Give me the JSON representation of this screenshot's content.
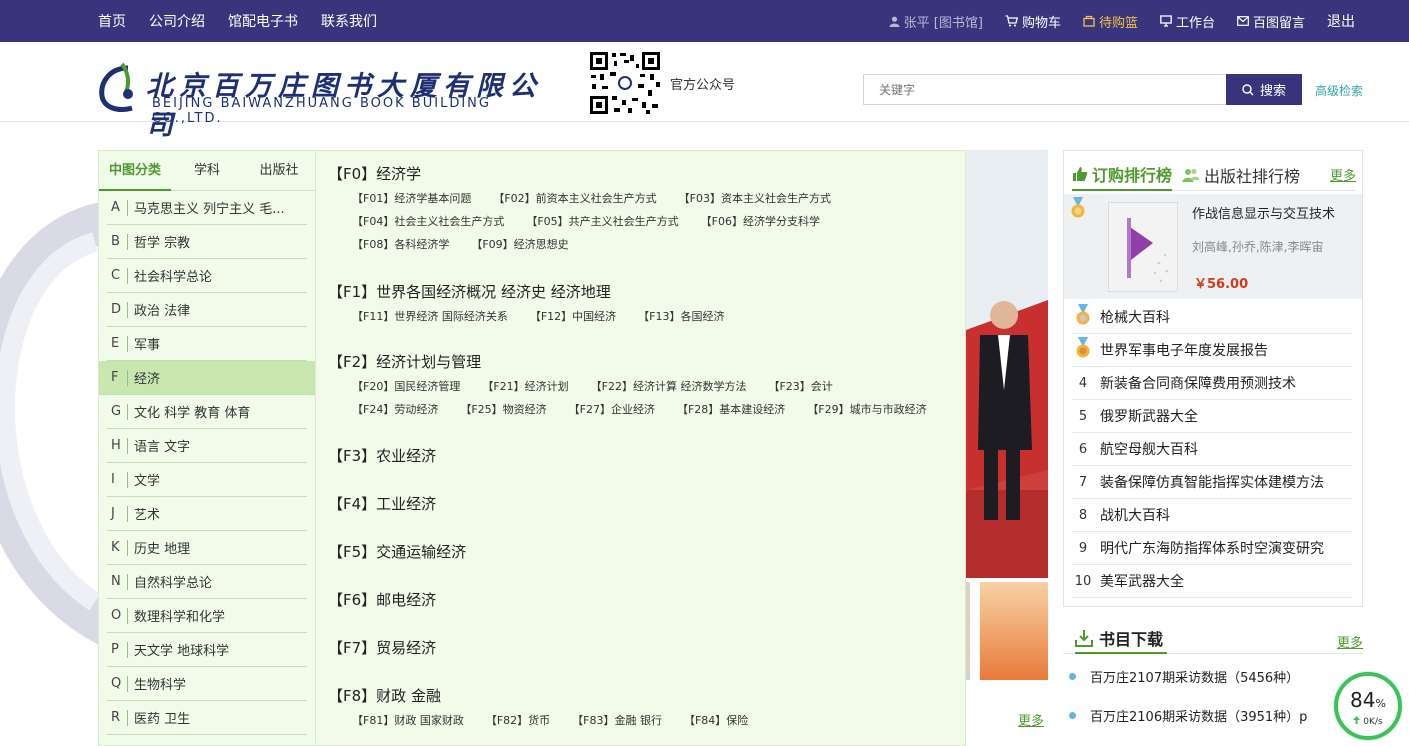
{
  "topnav": {
    "links": [
      "首页",
      "公司介绍",
      "馆配电子书",
      "联系我们"
    ],
    "user": "张平 [图书馆]",
    "cart": "购物车",
    "basket": "待购篮",
    "workbench": "工作台",
    "message": "百图留言",
    "logout": "退出"
  },
  "header": {
    "logo_cn": "北京百万庄图书大厦有限公司",
    "logo_en": "BEIJING BAIWANZHUANG BOOK BUILDING CO.,LTD.",
    "qr_label": "官方公众号",
    "search_placeholder": "关键字",
    "search_button": "搜索",
    "advanced_search": "高级检索"
  },
  "category_tabs": [
    "中图分类",
    "学科",
    "出版社"
  ],
  "categories": [
    {
      "code": "A",
      "name": "马克思主义 列宁主义 毛..."
    },
    {
      "code": "B",
      "name": "哲学 宗教"
    },
    {
      "code": "C",
      "name": "社会科学总论"
    },
    {
      "code": "D",
      "name": "政治 法律"
    },
    {
      "code": "E",
      "name": "军事"
    },
    {
      "code": "F",
      "name": "经济",
      "active": true
    },
    {
      "code": "G",
      "name": "文化 科学 教育 体育"
    },
    {
      "code": "H",
      "name": "语言 文字"
    },
    {
      "code": "I",
      "name": "文学"
    },
    {
      "code": "J",
      "name": "艺术"
    },
    {
      "code": "K",
      "name": "历史 地理"
    },
    {
      "code": "N",
      "name": "自然科学总论"
    },
    {
      "code": "O",
      "name": "数理科学和化学"
    },
    {
      "code": "P",
      "name": "天文学 地球科学"
    },
    {
      "code": "Q",
      "name": "生物科学"
    },
    {
      "code": "R",
      "name": "医药 卫生"
    }
  ],
  "subcategories": [
    {
      "head": "【F0】经济学",
      "items": [
        "【F01】经济学基本问题",
        "【F02】前资本主义社会生产方式",
        "【F03】资本主义社会生产方式",
        "【F04】社会主义社会生产方式",
        "【F05】共产主义社会生产方式",
        "【F06】经济学分支科学",
        "【F08】各科经济学",
        "【F09】经济思想史"
      ]
    },
    {
      "head": "【F1】世界各国经济概况 经济史 经济地理",
      "items": [
        "【F11】世界经济 国际经济关系",
        "【F12】中国经济",
        "【F13】各国经济"
      ]
    },
    {
      "head": "【F2】经济计划与管理",
      "items": [
        "【F20】国民经济管理",
        "【F21】经济计划",
        "【F22】经济计算 经济数学方法",
        "【F23】会计",
        "【F24】劳动经济",
        "【F25】物资经济",
        "【F27】企业经济",
        "【F28】基本建设经济",
        "【F29】城市与市政经济"
      ]
    },
    {
      "head": "【F3】农业经济",
      "items": []
    },
    {
      "head": "【F4】工业经济",
      "items": []
    },
    {
      "head": "【F5】交通运输经济",
      "items": []
    },
    {
      "head": "【F6】邮电经济",
      "items": []
    },
    {
      "head": "【F7】贸易经济",
      "items": []
    },
    {
      "head": "【F8】财政 金融",
      "items": [
        "【F81】财政 国家财政",
        "【F82】货币",
        "【F83】金融 银行",
        "【F84】保险"
      ]
    }
  ],
  "more_label": "更多",
  "ranking": {
    "tab_active": "订购排行榜",
    "tab_other": "出版社排行榜",
    "more": "更多",
    "top": {
      "title": "作战信息显示与交互技术",
      "author": "刘高峰,孙乔,陈津,李晖宙",
      "price": "￥56.00"
    },
    "rows": [
      {
        "no": "",
        "title": "枪械大百科",
        "medal": true
      },
      {
        "no": "",
        "title": "世界军事电子年度发展报告",
        "medal": true
      },
      {
        "no": "4",
        "title": "新装备合同商保障费用预测技术"
      },
      {
        "no": "5",
        "title": "俄罗斯武器大全"
      },
      {
        "no": "6",
        "title": "航空母舰大百科"
      },
      {
        "no": "7",
        "title": "装备保障仿真智能指挥实体建模方法"
      },
      {
        "no": "8",
        "title": "战机大百科"
      },
      {
        "no": "9",
        "title": "明代广东海防指挥体系时空演变研究"
      },
      {
        "no": "10",
        "title": "美军武器大全"
      }
    ]
  },
  "downloads": {
    "title": "书目下载",
    "more": "更多",
    "items": [
      "百万庄2107期采访数据（5456种）",
      "百万庄2106期采访数据（3951种）p"
    ]
  },
  "speed": {
    "percent": "84",
    "percent_unit": "%",
    "rate": "0K/s"
  },
  "colors": {
    "nav_bg": "#39357c",
    "accent_green": "#4d9b2e",
    "panel_bg": "#f0fbea",
    "price_red": "#d23a1c"
  }
}
